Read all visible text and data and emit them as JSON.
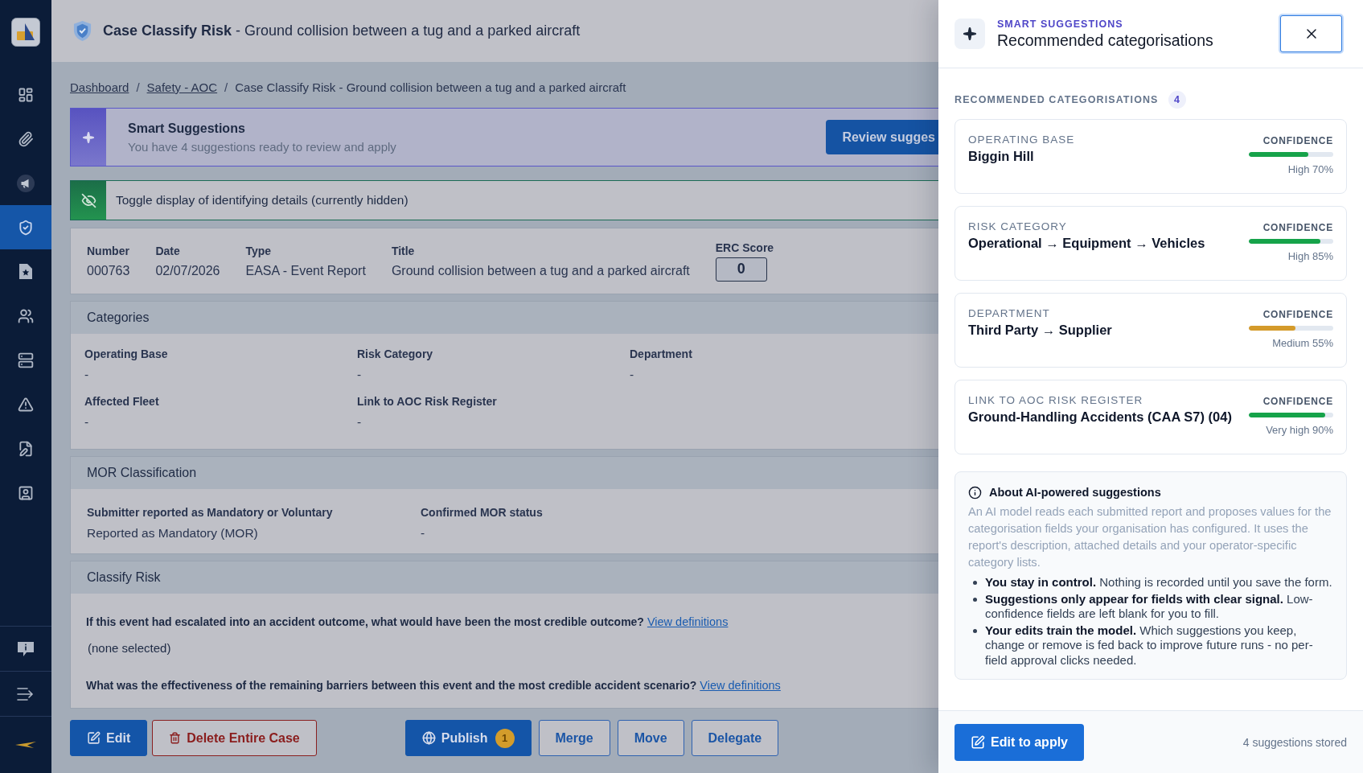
{
  "sidebar": {
    "items": [
      {
        "selected": false
      },
      {
        "selected": false
      },
      {
        "selected": false
      },
      {
        "selected": true
      },
      {
        "selected": false
      },
      {
        "selected": false
      },
      {
        "selected": false
      },
      {
        "selected": false
      },
      {
        "selected": false
      },
      {
        "selected": false
      }
    ]
  },
  "header": {
    "title": "**Case Classify Risk** - Ground collision between a tug and a parked aircraft"
  },
  "breadcrumb": [
    {
      "label": "Dashboard",
      "kind": "link"
    },
    {
      "separator": "/",
      "label": "Safety - AOC",
      "kind": "link"
    },
    {
      "separator": "/",
      "label": "Case Classify Risk - Ground collision between a tug and a parked aircraft",
      "kind": "current"
    }
  ],
  "smart_banner": {
    "title": "Smart Suggestions",
    "text": "You have 4 suggestions ready to review and apply",
    "button": "Review sugges"
  },
  "privacy_toggle": {
    "label": "Toggle display of identifying details (currently hidden)",
    "details_hidden": true
  },
  "case_summary": {
    "fields": [
      {
        "label": "Number",
        "value": "000763"
      },
      {
        "label": "Date",
        "value": "02/07/2026"
      },
      {
        "label": "Type",
        "value": "EASA - Event Report"
      },
      {
        "label": "Title",
        "value": "Ground collision between a tug and a parked aircraft"
      }
    ],
    "erc_score": {
      "label": "ERC Score",
      "value": "0"
    }
  },
  "sections": [
    {
      "title": "Categories",
      "kind": "grid",
      "fields": [
        {
          "label": "Operating Base",
          "value": "-"
        },
        {
          "label": "Risk Category",
          "value": "-"
        },
        {
          "label": "Department",
          "value": "-"
        },
        {
          "label": "Affected Fleet",
          "value": "-"
        },
        {
          "label": "Link to AOC Risk Register",
          "value": "-"
        }
      ]
    },
    {
      "title": "MOR Classification",
      "kind": "row",
      "fields": [
        {
          "label": "Submitter reported as Mandatory or Voluntary",
          "value": "Reported as Mandatory (MOR)"
        },
        {
          "label": "Confirmed MOR status",
          "value": "-"
        }
      ]
    },
    {
      "title": "Classify Risk",
      "kind": "questions",
      "questions": [
        {
          "text": "If this event had escalated into an accident outcome, what would have been the most credible outcome?",
          "link": "View definitions",
          "answer": "(none selected)"
        },
        {
          "text": "What was the effectiveness of the remaining barriers between this event and the most credible accident scenario?",
          "link": "View definitions"
        }
      ]
    }
  ],
  "actions": {
    "left": [
      {
        "label": "Edit",
        "kind": "edit"
      },
      {
        "label": "Delete Entire Case",
        "kind": "delete"
      }
    ],
    "center": [
      {
        "label": "Publish",
        "kind": "publish",
        "badge": "1"
      },
      {
        "label": "Merge",
        "kind": "outline"
      },
      {
        "label": "Move",
        "kind": "outline"
      },
      {
        "label": "Delegate",
        "kind": "outline"
      }
    ]
  },
  "drawer": {
    "eyebrow": "SMART SUGGESTIONS",
    "title": "Recommended categorisations",
    "section_label": "RECOMMENDED CATEGORISATIONS",
    "count": "4",
    "suggestions": [
      {
        "field": "OPERATING BASE",
        "value": "Biggin Hill",
        "confidence_label": "CONFIDENCE",
        "level": 0.7,
        "color": "#16a34a",
        "reading": "High 70%"
      },
      {
        "field": "RISK CATEGORY",
        "value": "Operational → Equipment → Vehicles",
        "confidence_label": "CONFIDENCE",
        "level": 0.85,
        "color": "#16a34a",
        "reading": "High 85%"
      },
      {
        "field": "DEPARTMENT",
        "value": "Third Party → Supplier",
        "confidence_label": "CONFIDENCE",
        "level": 0.55,
        "color": "#d49a2a",
        "reading": "Medium 55%"
      },
      {
        "field": "LINK TO AOC RISK REGISTER",
        "value": "Ground-Handling Accidents (CAA S7) (04)",
        "confidence_label": "CONFIDENCE",
        "level": 0.9,
        "color": "#16a34a",
        "reading": "Very high 90%"
      }
    ],
    "about": {
      "title": "About AI-powered suggestions",
      "text": "An AI model reads each submitted report and proposes values for the categorisation fields your organisation has configured. It uses the report's description, attached details and your operator-specific category lists.",
      "points": [
        "**You stay in control.** Nothing is recorded until you save the form.",
        "**Suggestions only appear for fields with clear signal.** Low-confidence fields are left blank for you to fill.",
        "**Your edits train the model.** Which suggestions you keep, change or remove is fed back to improve future runs - no per-field approval clicks needed."
      ]
    },
    "footer": {
      "button": "Edit to apply",
      "status": "4 suggestions stored"
    }
  }
}
